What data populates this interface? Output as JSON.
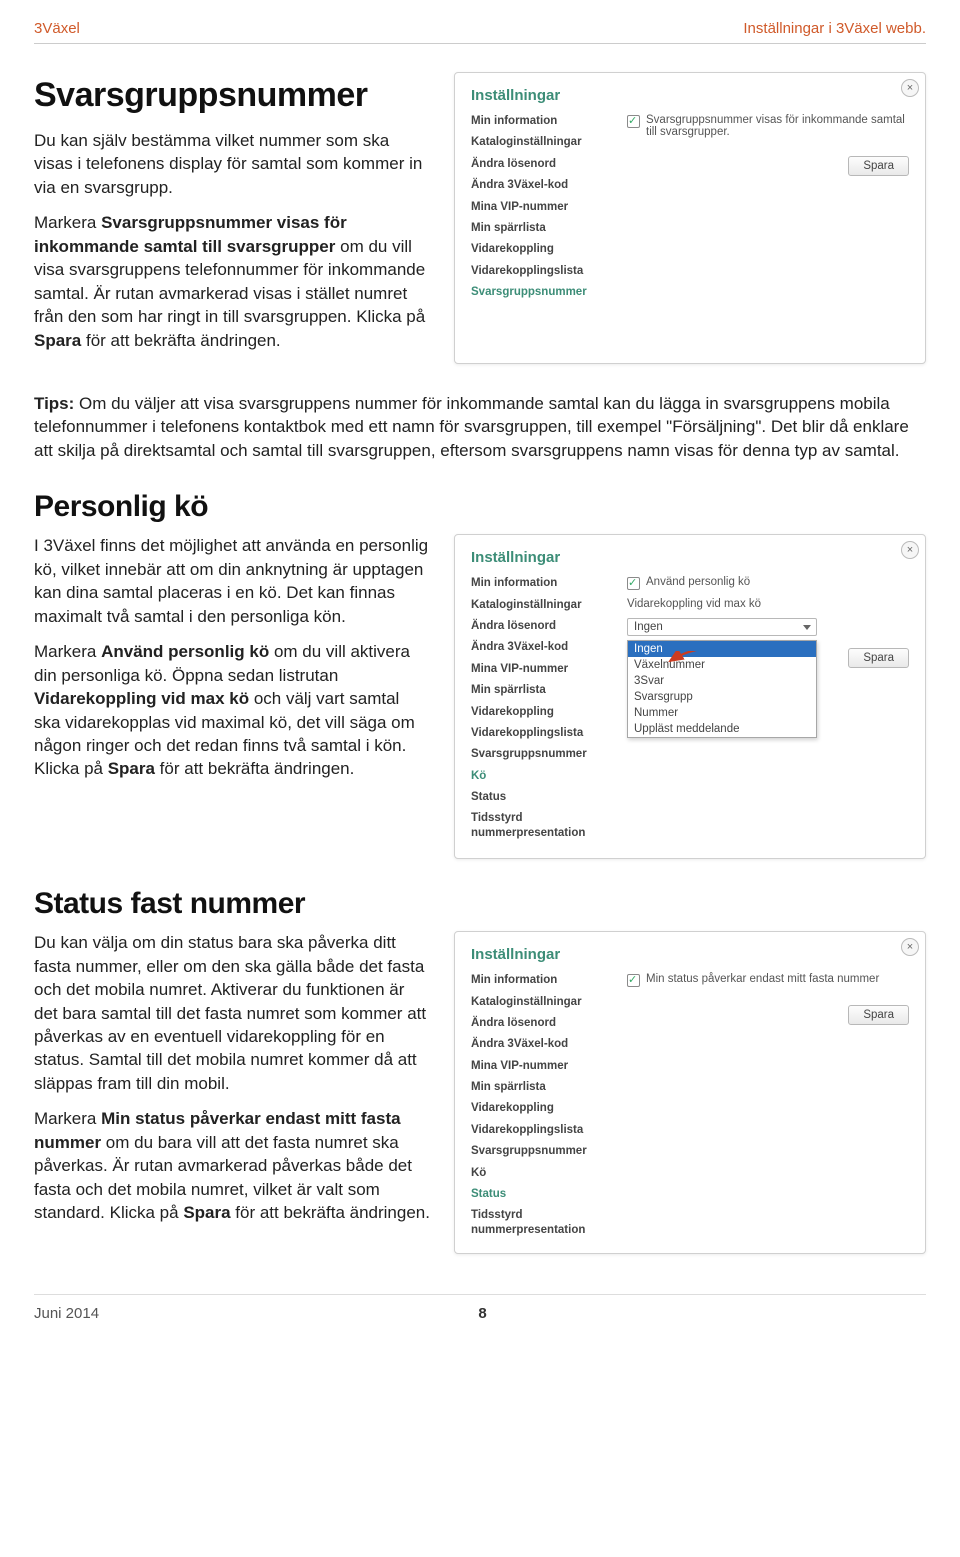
{
  "header": {
    "left": "3Växel",
    "right": "Inställningar i 3Växel webb."
  },
  "footer": {
    "left": "Juni 2014",
    "page": "8"
  },
  "s1": {
    "title": "Svarsgruppsnummer",
    "p1": "Du kan själv bestämma vilket nummer som ska visas i telefonens display för samtal som kommer in via en svarsgrupp.",
    "p2a": "Markera ",
    "p2b": "Svarsgruppsnummer visas för inkommande samtal till svarsgrupper",
    "p2c": " om du vill visa svarsgruppens telefonnummer för inkommande samtal. Är rutan avmarkerad visas i stället numret från den som har ringt in till svarsgruppen. Klicka på ",
    "p2d": "Spara",
    "p2e": " för att bekräfta ändringen.",
    "tips_lead": "Tips:",
    "tips": " Om du väljer att visa svarsgruppens nummer för inkommande samtal kan du lägga in svarsgruppens mobila telefonnummer i telefonens kontaktbok med ett namn för svarsgruppen, till exempel \"Försäljning\". Det blir då enklare att skilja på direktsamtal och samtal till svarsgruppen, eftersom svarsgruppens namn visas för denna typ av samtal."
  },
  "s2": {
    "title": "Personlig kö",
    "p1": "I 3Växel finns det möjlighet att använda en personlig kö, vilket innebär att om din anknytning är upptagen kan dina samtal placeras i en kö. Det kan finnas maximalt två samtal i den personliga kön.",
    "p2a": "Markera ",
    "p2b": "Använd personlig kö",
    "p2c": " om du vill aktivera din personliga kö. Öppna sedan listrutan ",
    "p2d": "Vidarekoppling vid max kö",
    "p2e": " och välj vart samtal ska vidarekopplas vid maximal kö, det vill säga om någon ringer och det redan finns två samtal i kön. Klicka på ",
    "p2f": "Spara",
    "p2g": " för att bekräfta ändringen."
  },
  "s3": {
    "title": "Status fast nummer",
    "p1": "Du kan välja om din status bara ska påverka ditt fasta nummer, eller om den ska gälla både det fasta och det mobila numret. Aktiverar du funktionen är det bara samtal till det fasta numret som kommer att påverkas av en eventuell vidarekoppling för en status. Samtal till det mobila numret kommer då att släppas fram till din mobil.",
    "p2a": "Markera ",
    "p2b": "Min status påverkar endast mitt fasta nummer",
    "p2c": " om du bara vill att det fasta numret ska påverkas. Är rutan avmarkerad påverkas både det fasta och det mobila numret, vilket är valt som standard. Klicka på ",
    "p2d": "Spara",
    "p2e": " för att bekräfta ändringen."
  },
  "shot_common": {
    "title": "Inställningar",
    "save": "Spara",
    "menu_base": [
      "Min information",
      "Kataloginställningar",
      "Ändra lösenord",
      "Ändra 3Växel-kod",
      "Mina VIP-nummer",
      "Min spärrlista",
      "Vidarekoppling",
      "Vidarekopplingslista",
      "Svarsgruppsnummer"
    ],
    "menu_ext": [
      "Kö",
      "Status",
      "Tidsstyrd nummerpresentation"
    ]
  },
  "shot1": {
    "checkbox_label": "Svarsgruppsnummer visas för inkommande samtal till svarsgrupper."
  },
  "shot2": {
    "chk_label": "Använd personlig kö",
    "field_label": "Vidarekoppling vid max kö",
    "selected": "Ingen",
    "options": [
      "Ingen",
      "Växelnummer",
      "3Svar",
      "Svarsgrupp",
      "Nummer",
      "Uppläst meddelande"
    ]
  },
  "shot3": {
    "chk_label": "Min status påverkar endast mitt fasta nummer"
  }
}
